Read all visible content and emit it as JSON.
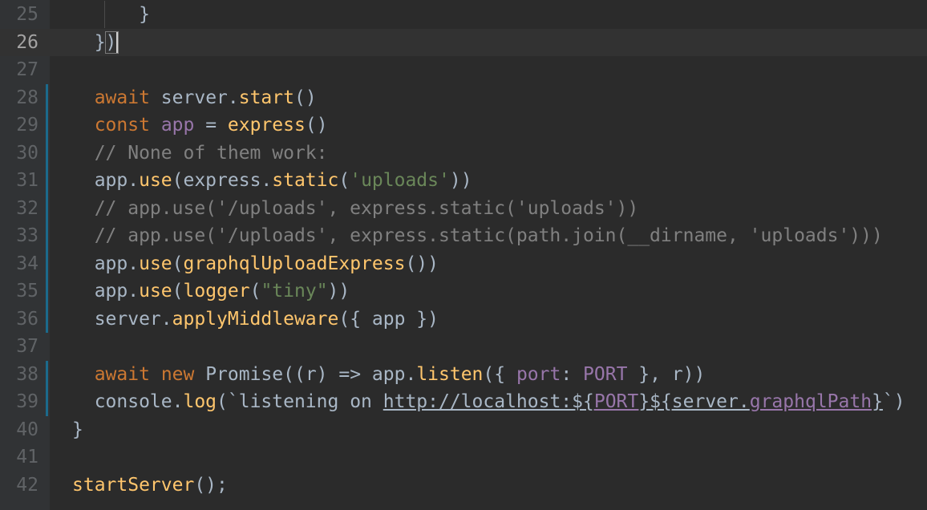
{
  "editor": {
    "current_line": "26",
    "lines": [
      {
        "number": "25",
        "changed": false,
        "tokens": [
          {
            "t": "      }",
            "c": "text"
          }
        ]
      },
      {
        "number": "26",
        "changed": false,
        "tokens": [
          {
            "t": "  })",
            "c": "text"
          }
        ]
      },
      {
        "number": "27",
        "changed": false,
        "tokens": []
      },
      {
        "number": "28",
        "changed": true,
        "tokens": [
          {
            "t": "  ",
            "c": "text"
          },
          {
            "t": "await",
            "c": "keyword"
          },
          {
            "t": " server.",
            "c": "text"
          },
          {
            "t": "start",
            "c": "func"
          },
          {
            "t": "()",
            "c": "text"
          }
        ]
      },
      {
        "number": "29",
        "changed": true,
        "tokens": [
          {
            "t": "  ",
            "c": "text"
          },
          {
            "t": "const",
            "c": "keyword"
          },
          {
            "t": " ",
            "c": "text"
          },
          {
            "t": "app",
            "c": "var"
          },
          {
            "t": " = ",
            "c": "text"
          },
          {
            "t": "express",
            "c": "func"
          },
          {
            "t": "()",
            "c": "text"
          }
        ]
      },
      {
        "number": "30",
        "changed": true,
        "tokens": [
          {
            "t": "  // None of them work:",
            "c": "comment"
          }
        ]
      },
      {
        "number": "31",
        "changed": true,
        "tokens": [
          {
            "t": "  app.",
            "c": "text"
          },
          {
            "t": "use",
            "c": "func"
          },
          {
            "t": "(express.",
            "c": "text"
          },
          {
            "t": "static",
            "c": "func"
          },
          {
            "t": "(",
            "c": "text"
          },
          {
            "t": "'uploads'",
            "c": "string"
          },
          {
            "t": "))",
            "c": "text"
          }
        ]
      },
      {
        "number": "32",
        "changed": true,
        "tokens": [
          {
            "t": "  // app.use('/uploads', express.static('uploads'))",
            "c": "comment"
          }
        ]
      },
      {
        "number": "33",
        "changed": true,
        "tokens": [
          {
            "t": "  // app.use('/uploads', express.static(path.join(__dirname, 'uploads')))",
            "c": "comment"
          }
        ]
      },
      {
        "number": "34",
        "changed": true,
        "tokens": [
          {
            "t": "  app.",
            "c": "text"
          },
          {
            "t": "use",
            "c": "func"
          },
          {
            "t": "(",
            "c": "text"
          },
          {
            "t": "graphqlUploadExpress",
            "c": "func"
          },
          {
            "t": "())",
            "c": "text"
          }
        ]
      },
      {
        "number": "35",
        "changed": true,
        "tokens": [
          {
            "t": "  app.",
            "c": "text"
          },
          {
            "t": "use",
            "c": "func"
          },
          {
            "t": "(",
            "c": "text"
          },
          {
            "t": "logger",
            "c": "func"
          },
          {
            "t": "(",
            "c": "text"
          },
          {
            "t": "\"tiny\"",
            "c": "string"
          },
          {
            "t": "))",
            "c": "text"
          }
        ]
      },
      {
        "number": "36",
        "changed": true,
        "tokens": [
          {
            "t": "  server.",
            "c": "text"
          },
          {
            "t": "applyMiddleware",
            "c": "func"
          },
          {
            "t": "({ app })",
            "c": "text"
          }
        ]
      },
      {
        "number": "37",
        "changed": false,
        "tokens": []
      },
      {
        "number": "38",
        "changed": true,
        "tokens": [
          {
            "t": "  ",
            "c": "text"
          },
          {
            "t": "await",
            "c": "keyword"
          },
          {
            "t": " ",
            "c": "text"
          },
          {
            "t": "new",
            "c": "keyword"
          },
          {
            "t": " Promise((r) => app.",
            "c": "text"
          },
          {
            "t": "listen",
            "c": "func"
          },
          {
            "t": "({ ",
            "c": "text"
          },
          {
            "t": "port",
            "c": "var"
          },
          {
            "t": ": ",
            "c": "text"
          },
          {
            "t": "PORT",
            "c": "var"
          },
          {
            "t": " }, r))",
            "c": "text"
          }
        ]
      },
      {
        "number": "39",
        "changed": true,
        "tokens": [
          {
            "t": "  console.",
            "c": "text"
          },
          {
            "t": "log",
            "c": "func"
          },
          {
            "t": "(`listening on ",
            "c": "text"
          },
          {
            "t": "http://localhost:${",
            "c": "link"
          },
          {
            "t": "PORT",
            "c": "link-var"
          },
          {
            "t": "}${server.",
            "c": "link"
          },
          {
            "t": "graphqlPath",
            "c": "link-var"
          },
          {
            "t": "}",
            "c": "link"
          },
          {
            "t": "`)",
            "c": "text"
          }
        ]
      },
      {
        "number": "40",
        "changed": false,
        "tokens": [
          {
            "t": "}",
            "c": "text"
          }
        ]
      },
      {
        "number": "41",
        "changed": false,
        "tokens": []
      },
      {
        "number": "42",
        "changed": false,
        "tokens": [
          {
            "t": "startServer",
            "c": "func"
          },
          {
            "t": "();",
            "c": "text"
          }
        ]
      }
    ]
  }
}
